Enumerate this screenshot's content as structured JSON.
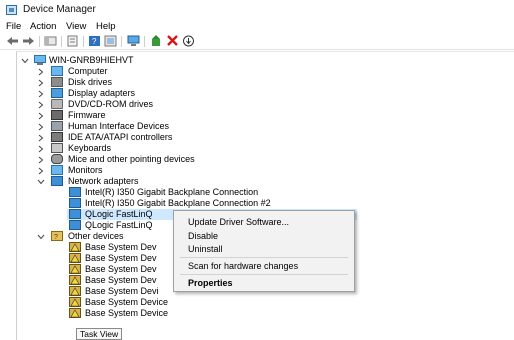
{
  "window": {
    "title": "Device Manager"
  },
  "menu": [
    "File",
    "Action",
    "View",
    "Help"
  ],
  "toolbar": {
    "buttons": [
      "back-icon",
      "forward-icon",
      "show-hide-tree-icon",
      "properties-icon",
      "help-icon",
      "show-hidden-icon",
      "scan-hardware-icon",
      "update-driver-icon",
      "uninstall-icon",
      "disable-icon"
    ]
  },
  "tree": {
    "root": "WIN-GNRB9HIEHVT",
    "categories": [
      {
        "label": "Computer",
        "icon": "computer-icon",
        "expanded": false
      },
      {
        "label": "Disk drives",
        "icon": "disk-drive-icon",
        "expanded": false
      },
      {
        "label": "Display adapters",
        "icon": "display-adapter-icon",
        "expanded": false
      },
      {
        "label": "DVD/CD-ROM drives",
        "icon": "dvd-drive-icon",
        "expanded": false
      },
      {
        "label": "Firmware",
        "icon": "firmware-icon",
        "expanded": false
      },
      {
        "label": "Human Interface Devices",
        "icon": "hid-icon",
        "expanded": false
      },
      {
        "label": "IDE ATA/ATAPI controllers",
        "icon": "ide-controller-icon",
        "expanded": false
      },
      {
        "label": "Keyboards",
        "icon": "keyboard-icon",
        "expanded": false
      },
      {
        "label": "Mice and other pointing devices",
        "icon": "mouse-icon",
        "expanded": false
      },
      {
        "label": "Monitors",
        "icon": "monitor-icon",
        "expanded": false
      },
      {
        "label": "Network adapters",
        "icon": "network-adapter-icon",
        "expanded": true
      }
    ],
    "network_adapters": [
      "Intel(R) I350 Gigabit Backplane Connection",
      "Intel(R) I350 Gigabit Backplane Connection #2",
      "QLogic FastLinQ",
      "QLogic FastLinQ"
    ],
    "other_devices_label": "Other devices",
    "other_devices": [
      "Base System Dev",
      "Base System Dev",
      "Base System Dev",
      "Base System Dev",
      "Base System Devi",
      "Base System Device",
      "Base System Device"
    ]
  },
  "context_menu": {
    "items": [
      {
        "label": "Update Driver Software...",
        "bold": false
      },
      {
        "label": "Disable",
        "bold": false
      },
      {
        "label": "Uninstall",
        "bold": false
      },
      {
        "label": "Scan for hardware changes",
        "bold": false
      },
      {
        "label": "Properties",
        "bold": true
      }
    ]
  },
  "tooltip": "Task View"
}
